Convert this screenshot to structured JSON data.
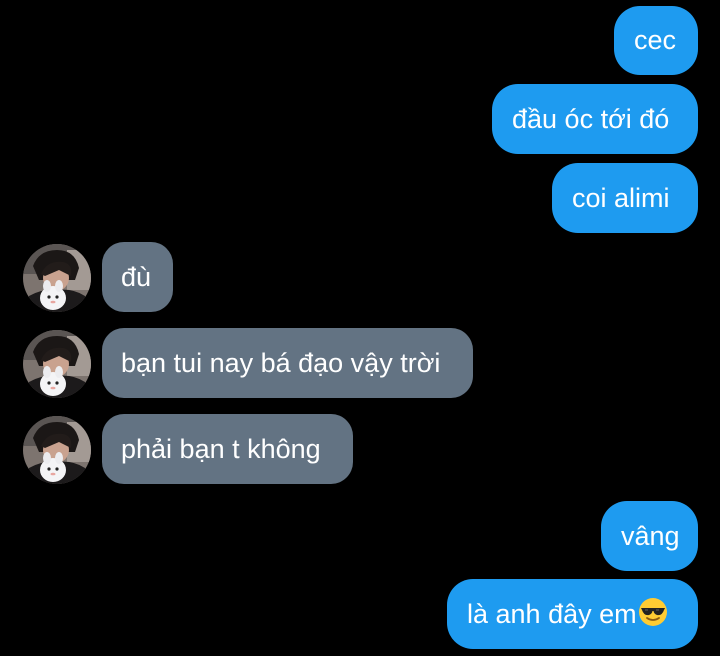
{
  "conversation": {
    "messages": [
      {
        "side": "sent",
        "text": "cec"
      },
      {
        "side": "sent",
        "text": "đầu óc tới đó"
      },
      {
        "side": "sent",
        "text": "coi alimi"
      },
      {
        "side": "received",
        "text": "đù"
      },
      {
        "side": "received",
        "text": "bạn tui nay bá đạo vậy trời"
      },
      {
        "side": "received",
        "text": "phải bạn t không"
      },
      {
        "side": "sent",
        "text": "vâng"
      },
      {
        "side": "sent",
        "text": "là anh đây em",
        "emoji": "smiling-face-with-sunglasses"
      }
    ]
  },
  "theme": {
    "background": "#000000",
    "sent_bubble": "#1e9bf0",
    "received_bubble": "#637383",
    "text": "#ffffff"
  }
}
